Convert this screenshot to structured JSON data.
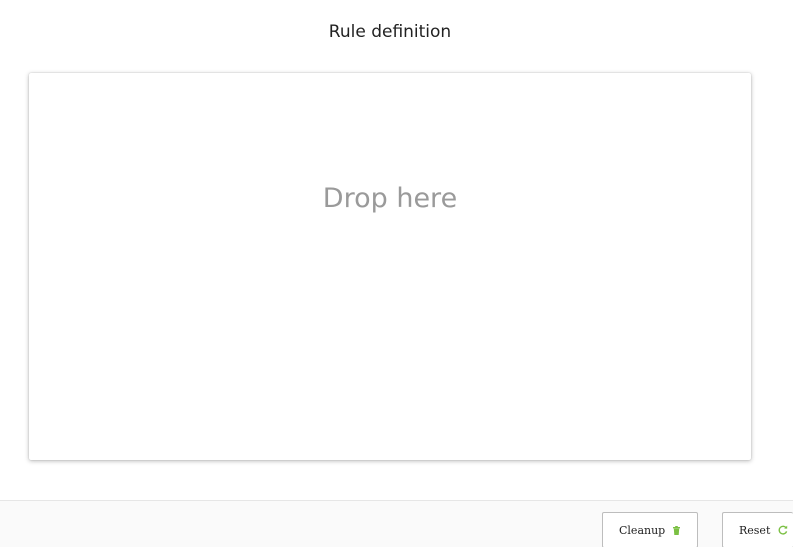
{
  "title": "Rule definition",
  "drop_zone": {
    "placeholder": "Drop here"
  },
  "footer": {
    "cleanup_label": "Cleanup",
    "cleanup_icon": "trash-icon",
    "reset_label": "Reset",
    "reset_icon": "refresh-icon",
    "icon_color": "#7bc043"
  }
}
